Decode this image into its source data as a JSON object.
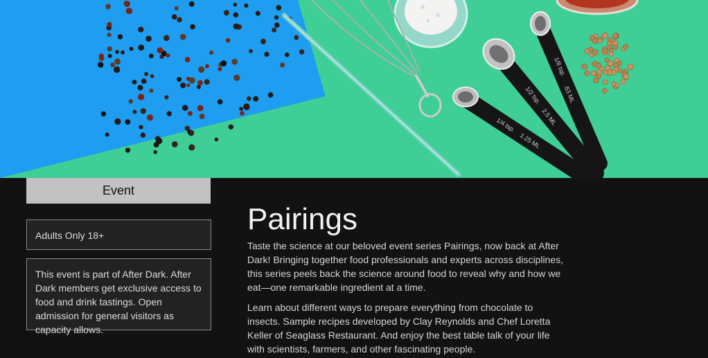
{
  "hero": {
    "spoon_labels": [
      "1/4 tsp.",
      "1.25 ML",
      "1/2 tsp.",
      "2.5 ML",
      "1/8 tsp.",
      ".63 ML"
    ]
  },
  "sidebar": {
    "badge": "Event",
    "age_restriction": "Adults Only 18+",
    "membership_note": "This event is part of After Dark. After Dark members get exclusive access to food and drink tastings. Open admission for general visitors as capacity allows."
  },
  "main": {
    "title": "Pairings",
    "paragraphs": [
      "Taste the science at our beloved event series Pairings, now back at After Dark! Bringing together food professionals and experts across disciplines, this series peels back the science around food to reveal why and how we eat—one remarkable ingredient at a time.",
      "Learn about different ways to prepare everything from chocolate to insects. Sample recipes developed by Clay Reynolds and Chef Loretta Keller of Seaglass Restaurant. And enjoy the best table talk of your life with scientists, farmers, and other fascinating people."
    ]
  },
  "colors": {
    "background": "#121212",
    "hero_blue": "#1e9ef0",
    "hero_green": "#3fcf96",
    "badge_bg": "#c2c2c2"
  }
}
